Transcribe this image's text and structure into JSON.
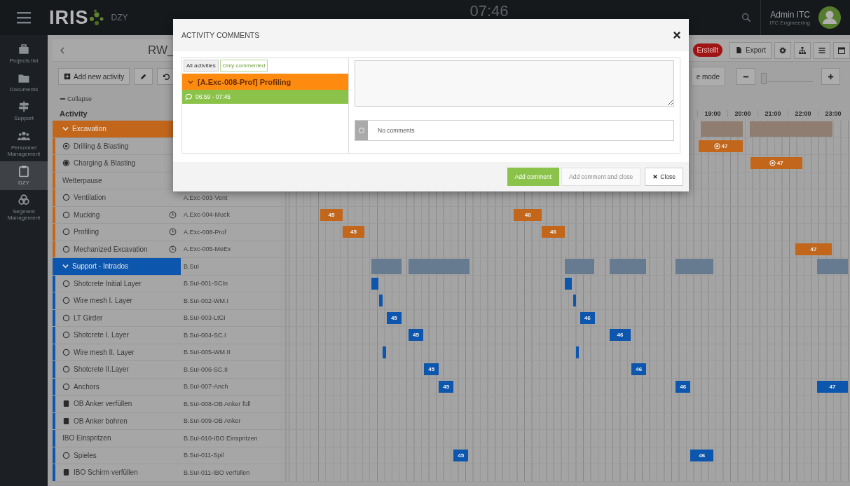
{
  "topbar": {
    "logo": "IRIS",
    "module": "DZY",
    "clock": "07:46",
    "user": {
      "name": "Admin ITC",
      "company": "ITC Engineering"
    }
  },
  "sidebar": {
    "items": [
      {
        "label": "Projects list",
        "selected": false
      },
      {
        "label": "Documents",
        "selected": false
      },
      {
        "label": "Support",
        "selected": false
      },
      {
        "label": "Personnel Management",
        "selected": false
      },
      {
        "label": "DZY",
        "selected": true
      },
      {
        "label": "Segment Management",
        "selected": false
      }
    ]
  },
  "plan": {
    "title": "RW_",
    "status": "Erstellt",
    "export": "Export",
    "add_activity": "Add new activity",
    "mode_button": "e mode",
    "zoom": {
      "level": 0.05
    },
    "collapse": "Collapse",
    "activity_header": "Activity",
    "hours": [
      "19:00",
      "20:00",
      "21:00",
      "22:00",
      "23:00"
    ],
    "rows": [
      {
        "name": "Excavation",
        "color": "#c2661c",
        "expanded": true,
        "children": [
          {
            "name": "Drilling & Blasting",
            "kind": "target",
            "timed": false,
            "bars": [
              {
                "label": "47",
                "flagged": true
              }
            ]
          },
          {
            "name": "Charging & Blasting",
            "kind": "filled",
            "timed": false,
            "bars": [
              {
                "label": "47",
                "flagged": true
              }
            ]
          },
          {
            "name": "Wetterpause",
            "kind": "plain",
            "timed": false
          },
          {
            "name": "Ventilation",
            "kind": "open",
            "timed": false,
            "code": "A.Exc-003-Vent"
          },
          {
            "name": "Mucking",
            "kind": "open",
            "timed": true,
            "code": "A.Exc-004-Muck",
            "bars": [
              {
                "label": "45",
                "flagged": false
              },
              {
                "label": "46",
                "flagged": false
              }
            ]
          },
          {
            "name": "Profiling",
            "kind": "open",
            "timed": true,
            "code": "A.Exc-008-Prof",
            "bars": [
              {
                "label": "45",
                "flagged": false
              },
              {
                "label": "46",
                "flagged": false
              }
            ]
          },
          {
            "name": "Mechanized Excavation",
            "kind": "open",
            "timed": true,
            "code": "A.Exc-005-MeEx",
            "bars": [
              {
                "label": "47",
                "flagged": false
              }
            ]
          }
        ]
      },
      {
        "name": "Support - Intrados",
        "color": "#0d56ad",
        "expanded": true,
        "code": "B.SuI",
        "children": [
          {
            "name": "Shotcrete Initial Layer",
            "kind": "open",
            "timed": false,
            "code": "B.SuI-001-SCIn",
            "bars": [
              {
                "flagged": false
              },
              {
                "flagged": false
              }
            ]
          },
          {
            "name": "Wire mesh I. Layer",
            "kind": "open",
            "timed": false,
            "code": "B.SuI-002-WM.I",
            "bars": [
              {
                "flagged": false
              },
              {
                "flagged": false
              }
            ]
          },
          {
            "name": "LT Girder",
            "kind": "open",
            "timed": false,
            "code": "B.SuI-003-LtGi",
            "bars": [
              {
                "label": "45",
                "flagged": false
              },
              {
                "label": "46",
                "flagged": false
              }
            ]
          },
          {
            "name": "Shotcrete I. Layer",
            "kind": "open",
            "timed": false,
            "code": "B.SuI-004-SC.I",
            "bars": [
              {
                "label": "45",
                "flagged": false
              },
              {
                "label": "46",
                "flagged": false
              }
            ]
          },
          {
            "name": "Wire mesh II. Layer",
            "kind": "open",
            "timed": false,
            "code": "B.SuI-005-WM.II",
            "bars": [
              {
                "flagged": false
              },
              {
                "flagged": false
              }
            ]
          },
          {
            "name": "Shotcrete II.Layer",
            "kind": "open",
            "timed": false,
            "code": "B.SuI-006-SC.II",
            "bars": [
              {
                "label": "45",
                "flagged": false
              },
              {
                "label": "46",
                "flagged": false
              }
            ]
          },
          {
            "name": "Anchors",
            "kind": "open",
            "timed": false,
            "code": "B.SuI-007-Anch",
            "bars": [
              {
                "label": "45",
                "flagged": false
              },
              {
                "label": "46",
                "flagged": false
              },
              {
                "label": "47",
                "flagged": false
              }
            ]
          },
          {
            "name": "OB Anker verfüllen",
            "kind": "sheet",
            "timed": false,
            "code": "B.SuI-008-OB Anker füll"
          },
          {
            "name": "OB Anker bohren",
            "kind": "sheet",
            "timed": false,
            "code": "B.SuI-009-OB Anker"
          },
          {
            "name": "IBO Einspritzen",
            "kind": "plain",
            "timed": false,
            "code": "B.SuI-010-IBO Einspritzen"
          },
          {
            "name": "Spieles",
            "kind": "open",
            "timed": false,
            "code": "B.SuI-011-Spil",
            "bars": [
              {
                "label": "45",
                "flagged": false
              },
              {
                "label": "46",
                "flagged": false
              }
            ]
          },
          {
            "name": "IBO Schirm verfüllen",
            "kind": "sheet",
            "timed": false,
            "code": "B.SuI-011-IBO verfüllen"
          }
        ]
      }
    ]
  },
  "modal": {
    "title": "ACTIVITY COMMENTS",
    "tabs": [
      {
        "label": "All activities",
        "selected": false
      },
      {
        "label": "Only commented",
        "selected": true
      }
    ],
    "activity": {
      "label": "[A.Exc-008-Prof] Profiling",
      "expanded": true,
      "entries": [
        {
          "label": "06:59 - 07:45",
          "selected": true
        }
      ]
    },
    "comments_empty": "No comments",
    "buttons": [
      {
        "label": "Add comment",
        "kind": "primary",
        "disabled": false
      },
      {
        "label": "Add comment and close",
        "kind": "primary",
        "disabled": true
      },
      {
        "label": "Close",
        "kind": "close",
        "disabled": false
      }
    ]
  }
}
